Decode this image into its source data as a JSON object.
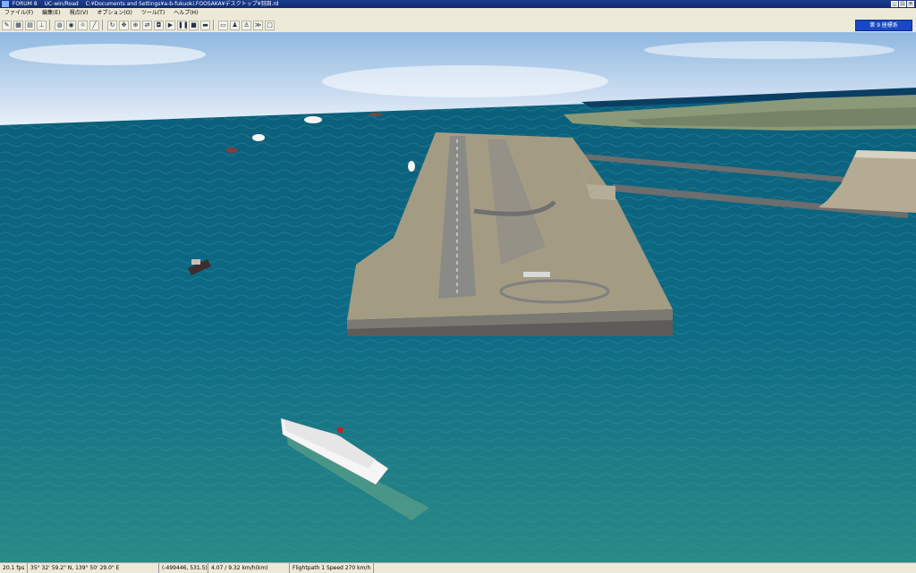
{
  "window": {
    "app_name": "FORUM 8",
    "product": "UC-win/Road",
    "file_path": "C:¥Documents and Settings¥a-b-fukuoki.FOOSAKA¥デスクトップ¥羽田.rd"
  },
  "menu": [
    "ファイル(F)",
    "編集(E)",
    "視点(V)",
    "オプション(O)",
    "ツール(T)",
    "ヘルプ(H)"
  ],
  "toolbar": {
    "buttons": [
      "pen-icon",
      "grid-icon",
      "map-icon",
      "person-icon",
      "globe-icon",
      "eye-icon",
      "light-icon",
      "road-icon",
      "rotate-icon",
      "pan-icon",
      "zoom-icon",
      "move-icon",
      "camera-icon",
      "play-icon",
      "pause-icon",
      "stop-icon",
      "car-icon",
      "monitor-icon",
      "walk-icon",
      "stand-icon",
      "run-icon",
      "square-icon"
    ],
    "view_label": "第 9 座標系"
  },
  "status": {
    "fps": "20.1 fps",
    "coords": "35° 32' 59.2\" N, 139° 50' 29.0\" E",
    "position": "(-499446, 531.5)",
    "speed": "4.07 / 9.32 km/h(km)",
    "flightpath": "Flightpath 1 Speed 270 km/h"
  }
}
